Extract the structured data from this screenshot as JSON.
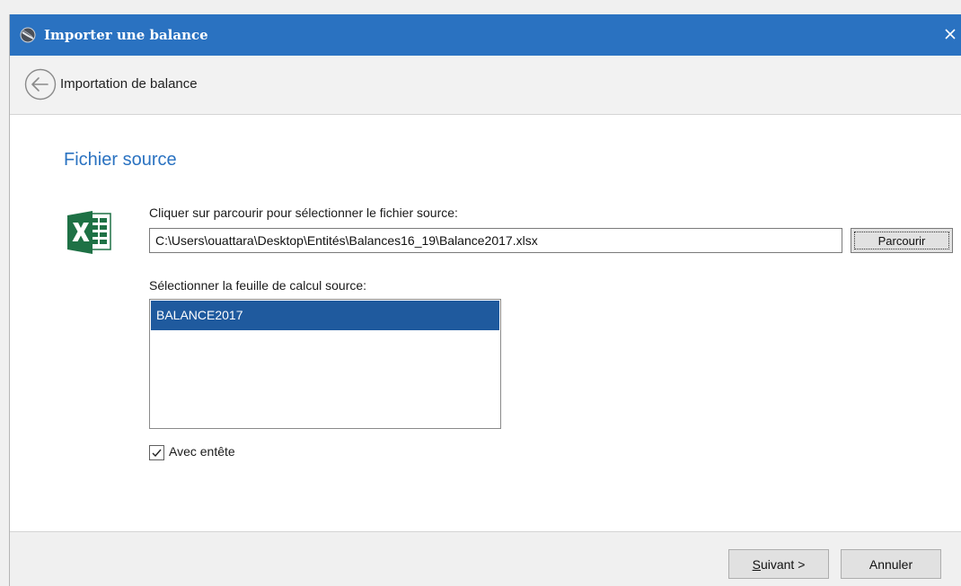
{
  "window": {
    "title": "Importer une balance",
    "close_glyph": "×",
    "colors": {
      "titlebar": "#2a72c1",
      "accent": "#2a72c1",
      "selection": "#1f5a9e",
      "excel_green": "#1e7145"
    }
  },
  "nav": {
    "title": "Importation de balance",
    "back_icon": "back-arrow-icon"
  },
  "section": {
    "title": "Fichier source",
    "icon": "excel-icon"
  },
  "file": {
    "label": "Cliquer sur parcourir pour sélectionner le fichier source:",
    "path": "C:\\Users\\ouattara\\Desktop\\Entités\\Balances16_19\\Balance2017.xlsx",
    "browse_label": "Parcourir"
  },
  "sheet": {
    "label": "Sélectionner la feuille de calcul source:",
    "items": [
      {
        "label": "BALANCE2017",
        "selected": true
      }
    ]
  },
  "header_option": {
    "label": "Avec entête",
    "checked": true
  },
  "footer": {
    "next_mnemonic": "S",
    "next_rest": "uivant >",
    "cancel_label": "Annuler"
  }
}
